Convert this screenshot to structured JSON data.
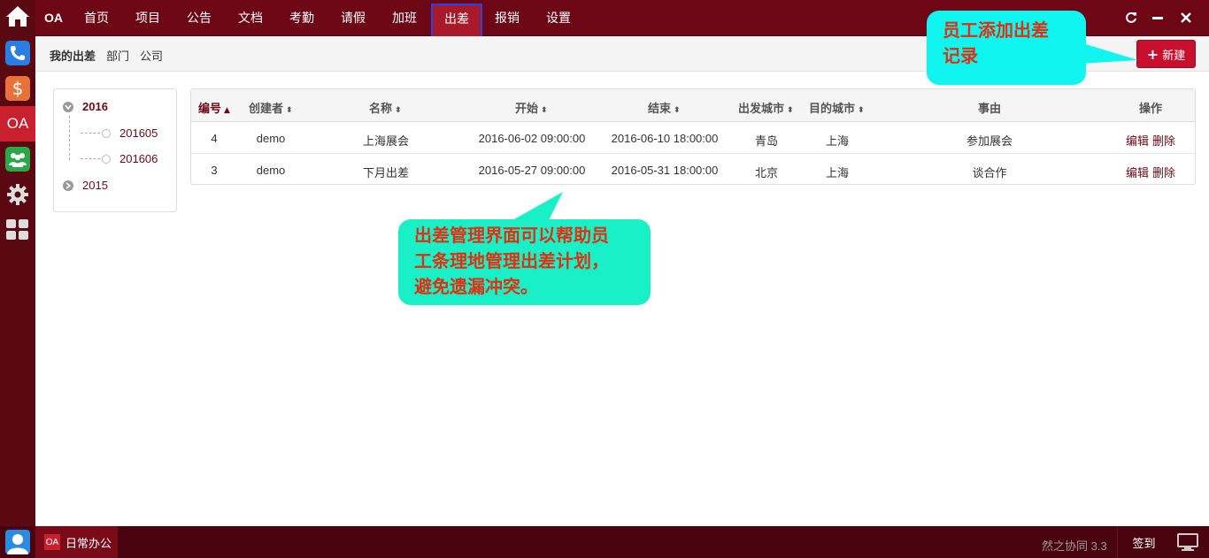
{
  "nav": {
    "brand": "OA",
    "items": [
      "首页",
      "项目",
      "公告",
      "文档",
      "考勤",
      "请假",
      "加班",
      "出差",
      "报销",
      "设置"
    ],
    "active_index": 7
  },
  "leftbar": {
    "money_glyph": "$",
    "oa_label": "OA"
  },
  "subtabs": [
    "我的出差",
    "部门",
    "公司"
  ],
  "new_button": {
    "label": "新建"
  },
  "tree": {
    "year_open": "2016",
    "months": [
      "201605",
      "201606"
    ],
    "year_closed": "2015"
  },
  "table": {
    "headers": [
      "编号",
      "创建者",
      "名称",
      "开始",
      "结束",
      "出发城市",
      "目的城市",
      "事由",
      "操作"
    ],
    "rows": [
      {
        "id": "4",
        "creator": "demo",
        "name": "上海展会",
        "start": "2016-06-02 09:00:00",
        "end": "2016-06-10 18:00:00",
        "from": "青岛",
        "to": "上海",
        "reason": "参加展会",
        "edit": "编辑",
        "delete": "删除"
      },
      {
        "id": "3",
        "creator": "demo",
        "name": "下月出差",
        "start": "2016-05-27 09:00:00",
        "end": "2016-05-31 18:00:00",
        "from": "北京",
        "to": "上海",
        "reason": "谈合作",
        "edit": "编辑",
        "delete": "删除"
      }
    ]
  },
  "callouts": {
    "top_line1": "员工添加出差",
    "top_line2": "记录",
    "mid_line1": "出差管理界面可以帮助员",
    "mid_line2": "工条理地管理出差计划，",
    "mid_line3": "避免遗漏冲突。"
  },
  "bottom": {
    "task_icon": "OA",
    "task_label": "日常办公",
    "version": "然之协同 3.3",
    "signin": "签到"
  },
  "colors": {
    "nav_bg": "#6e0715",
    "leftbar_bg": "#5a0912",
    "accent_red": "#c8102e",
    "active_border": "#2244ee",
    "callout_cyan": "#10f5f0",
    "callout_text": "#e03010"
  }
}
